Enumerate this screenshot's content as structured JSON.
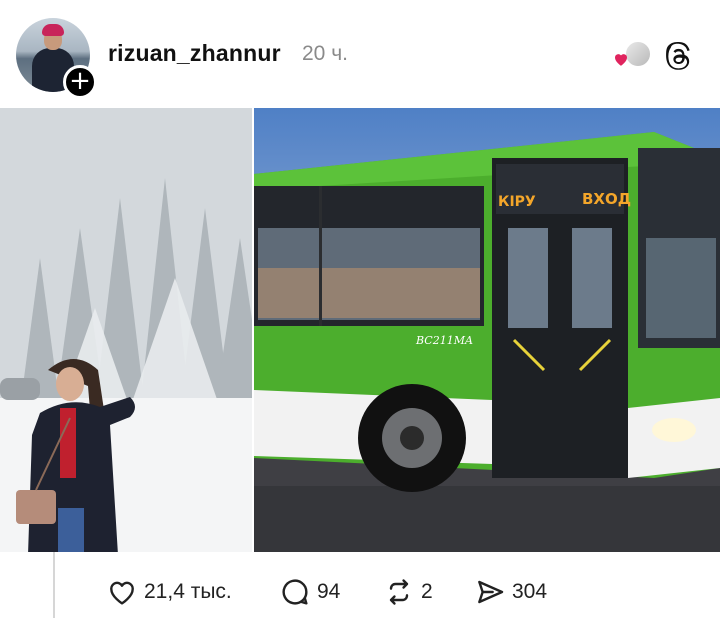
{
  "post": {
    "author": {
      "username": "rizuan_zhannur",
      "timestamp": "20 ч."
    },
    "header_icons": {
      "follow": "plus-icon",
      "liked_by": "liked-by-avatar",
      "app": "threads-logo-icon"
    },
    "images": [
      {
        "description_icon": "photo-woman-snowy-forest"
      },
      {
        "description_icon": "photo-green-bus",
        "sign_left": "КІРУ",
        "sign_right": "ВХОД",
        "plate": "BC211MA"
      }
    ],
    "actions": {
      "likes": "21,4 тыс.",
      "comments": "94",
      "reposts": "2",
      "shares": "304"
    }
  },
  "colors": {
    "heart": "#e0245e",
    "bus_green": "#4faf2e",
    "text_muted": "#8a8a8a"
  }
}
